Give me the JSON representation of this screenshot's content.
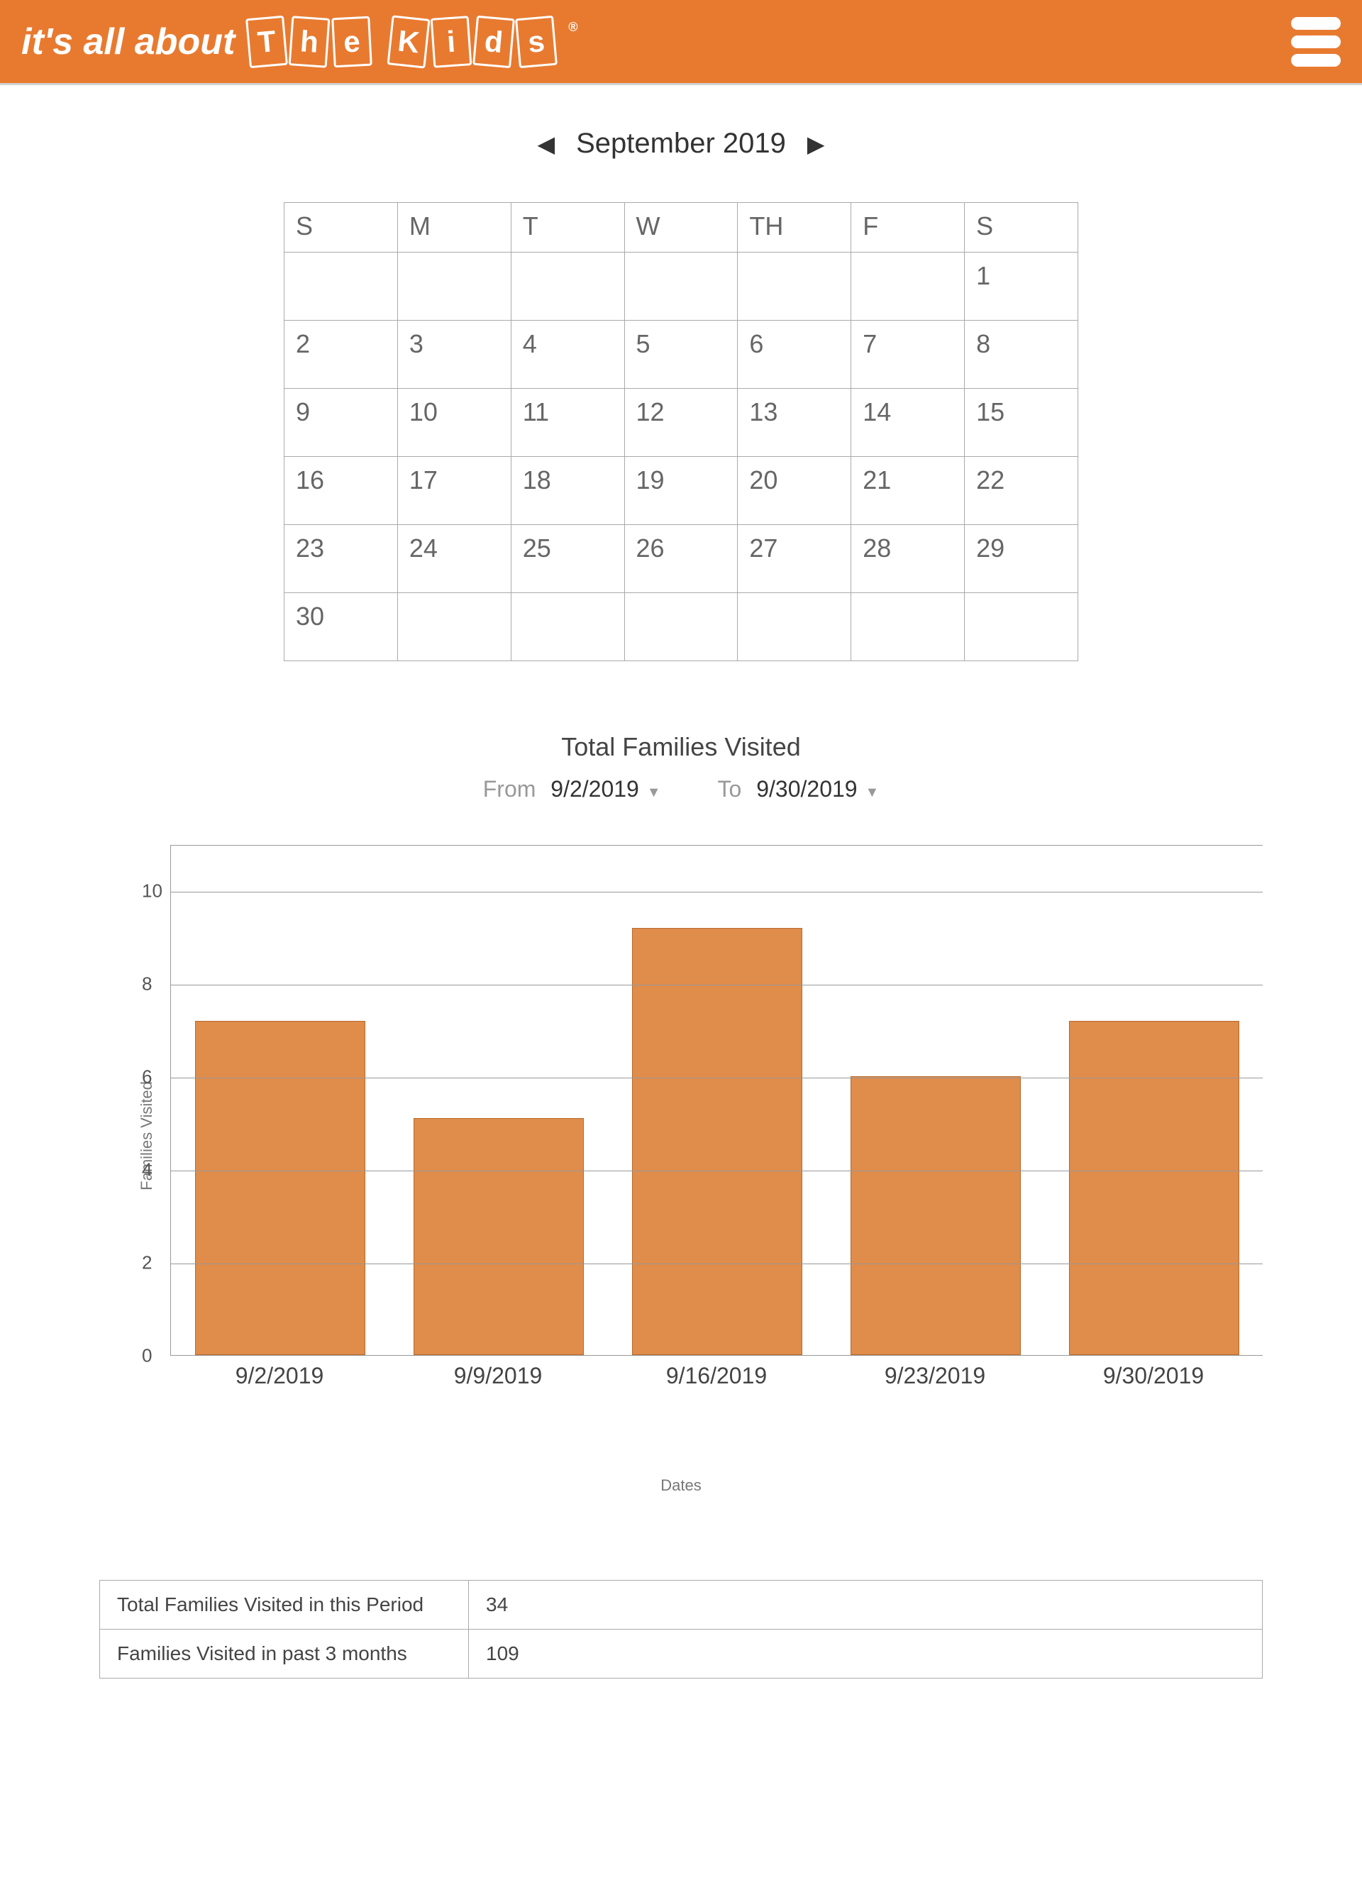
{
  "header": {
    "tagline": "it's all about",
    "brand_letters": [
      "T",
      "h",
      "e",
      "K",
      "i",
      "d",
      "s"
    ],
    "registered": "®"
  },
  "calendar": {
    "month_label": "September 2019",
    "day_headers": [
      "S",
      "M",
      "T",
      "W",
      "TH",
      "F",
      "S"
    ],
    "weeks": [
      [
        "",
        "",
        "",
        "",
        "",
        "",
        "1"
      ],
      [
        "2",
        "3",
        "4",
        "5",
        "6",
        "7",
        "8"
      ],
      [
        "9",
        "10",
        "11",
        "12",
        "13",
        "14",
        "15"
      ],
      [
        "16",
        "17",
        "18",
        "19",
        "20",
        "21",
        "22"
      ],
      [
        "23",
        "24",
        "25",
        "26",
        "27",
        "28",
        "29"
      ],
      [
        "30",
        "",
        "",
        "",
        "",
        "",
        ""
      ]
    ]
  },
  "chart_section": {
    "title": "Total Families Visited",
    "from_label": "From",
    "from_value": "9/2/2019",
    "to_label": "To",
    "to_value": "9/30/2019"
  },
  "chart_data": {
    "type": "bar",
    "categories": [
      "9/2/2019",
      "9/9/2019",
      "9/16/2019",
      "9/23/2019",
      "9/30/2019"
    ],
    "values": [
      7.2,
      5.1,
      9.2,
      6.0,
      7.2
    ],
    "yticks": [
      0,
      2,
      4,
      6,
      8,
      10
    ],
    "ylim": [
      0,
      11
    ],
    "ylabel": "Families Visited",
    "xlabel": "Dates",
    "title": "Total Families Visited"
  },
  "summary": {
    "rows": [
      {
        "label": "Total Families Visited in this Period",
        "value": "34"
      },
      {
        "label": "Families Visited in past 3 months",
        "value": "109"
      }
    ]
  }
}
